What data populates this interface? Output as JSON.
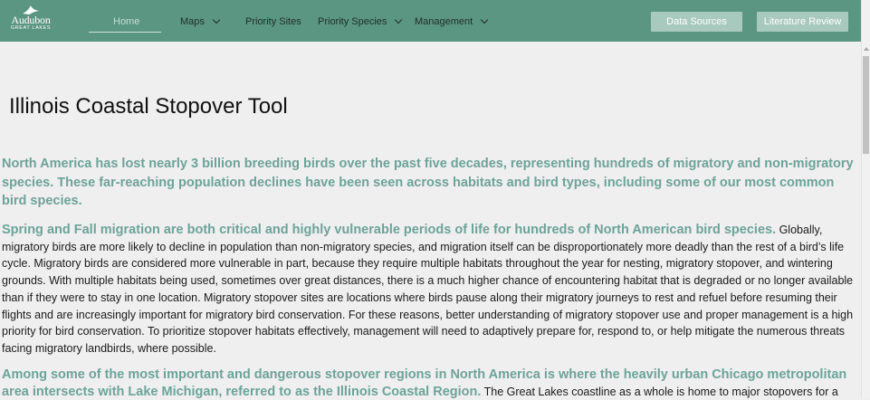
{
  "nav": {
    "logo": {
      "name": "Audubon",
      "sub": "GREAT LAKES"
    },
    "items": [
      {
        "label": "Home",
        "active": true
      },
      {
        "label": "Maps",
        "dropdown": true
      },
      {
        "label": "Priority Sites",
        "dropdown": false
      },
      {
        "label": "Priority Species",
        "dropdown": true
      },
      {
        "label": "Management",
        "dropdown": true
      }
    ],
    "buttons": [
      "Data Sources",
      "Literature Review"
    ]
  },
  "page": {
    "title": "Illinois Coastal Stopover Tool",
    "lead": "North America has lost nearly 3 billion breeding birds over the past five decades, representing hundreds of migratory and non-migratory species. These far-reaching population declines have been seen across habitats and bird types, including some of our most common bird species.",
    "paragraphs": [
      {
        "highlight": "Spring and Fall migration are both critical and highly vulnerable periods of life for hundreds of North American bird species.",
        "text": " Globally, migratory birds are more likely to decline in population than non-migratory species, and migration itself can be disproportionately more deadly than the rest of a bird’s life cycle. Migratory birds are considered more vulnerable in part, because they require multiple habitats throughout the year for nesting, migratory stopover, and wintering grounds. With multiple habitats being used, sometimes over great distances, there is a much higher chance of encountering habitat that is degraded or no longer available than if they were to stay in one location. Migratory stopover sites are locations where birds pause along their migratory journeys to rest and refuel before resuming their flights and are increasingly important for migratory bird conservation. For these reasons, better understanding of migratory stopover use and proper management is a high priority for bird conservation. To prioritize stopover habitats effectively, management will need to adaptively prepare for, respond to, or help mitigate the numerous threats facing migratory landbirds, where possible."
      },
      {
        "highlight": "Among some of the most important and dangerous stopover regions in North America is where the heavily urban Chicago metropolitan area intersects with Lake Michigan, referred to as the Illinois Coastal Region.",
        "text": " The Great Lakes coastline as a whole is home to major stopovers for a"
      }
    ]
  },
  "colors": {
    "nav_bg": "#5a9682",
    "accent_text": "#6da398",
    "button_bg": "#a8c9be",
    "page_bg": "#efefef"
  },
  "icons": [
    "audubon-bird-logo-icon",
    "chevron-down-icon"
  ]
}
